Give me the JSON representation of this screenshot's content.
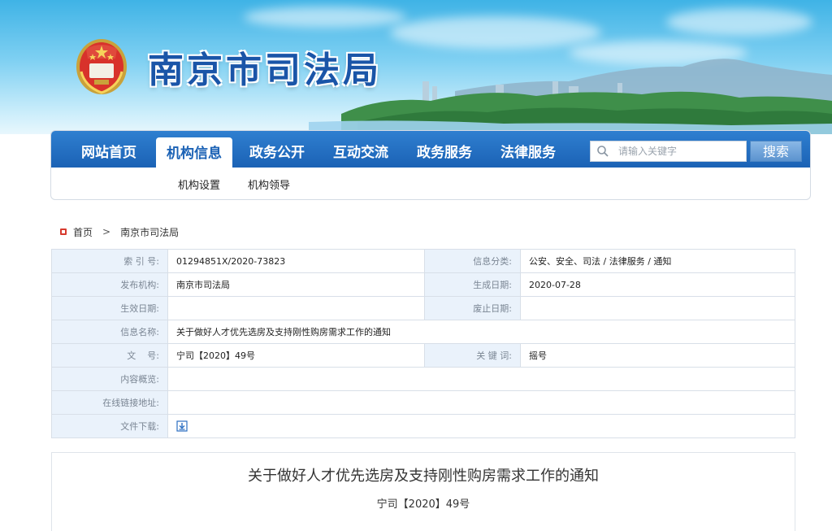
{
  "header": {
    "site_title": "南京市司法局",
    "emblem": "justice-emblem"
  },
  "nav": {
    "items": [
      {
        "label": "网站首页",
        "active": false
      },
      {
        "label": "机构信息",
        "active": true
      },
      {
        "label": "政务公开",
        "active": false
      },
      {
        "label": "互动交流",
        "active": false
      },
      {
        "label": "政务服务",
        "active": false
      },
      {
        "label": "法律服务",
        "active": false
      }
    ],
    "search_placeholder": "请输入关键字",
    "search_button": "搜索",
    "subnav": [
      "机构设置",
      "机构领导"
    ]
  },
  "breadcrumb": {
    "home": "首页",
    "separator": ">",
    "current": "南京市司法局"
  },
  "info": {
    "index_label": "索 引 号:",
    "index_value": "01294851X/2020-73823",
    "category_label": "信息分类:",
    "category_value": "公安、安全、司法 / 法律服务 / 通知",
    "publisher_label": "发布机构:",
    "publisher_value": "南京市司法局",
    "created_label": "生成日期:",
    "created_value": "2020-07-28",
    "effective_label": "生效日期:",
    "effective_value": "",
    "expire_label": "废止日期:",
    "expire_value": "",
    "name_label": "信息名称:",
    "name_value": "关于做好人才优先选房及支持刚性购房需求工作的通知",
    "docno_label": "文    号:",
    "docno_value": "宁司【2020】49号",
    "keyword_label": "关 键 词:",
    "keyword_value": "摇号",
    "overview_label": "内容概览:",
    "overview_value": "",
    "link_label": "在线链接地址:",
    "link_value": "",
    "download_label": "文件下载:"
  },
  "article": {
    "title": "关于做好人才优先选房及支持刚性购房需求工作的通知",
    "doc_number": "宁司【2020】49号"
  },
  "colors": {
    "nav_blue": "#1b62b5",
    "title_blue": "#1a55a8",
    "label_bg": "#eaf2fb",
    "home_red": "#d73a2e"
  }
}
